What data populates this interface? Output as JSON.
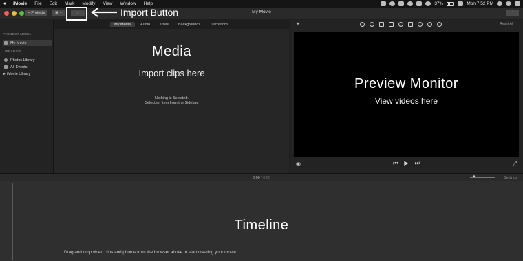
{
  "menubar": {
    "app": "iMovie",
    "items": [
      "File",
      "Edit",
      "Mark",
      "Modify",
      "View",
      "Window",
      "Help"
    ],
    "battery": "37%",
    "clock": "Mon 7:52 PM"
  },
  "toolbar": {
    "projects_label": "< Projects",
    "view_label": "▦ ▾",
    "import_label": "↓",
    "title": "My Movie",
    "share_label": "↑",
    "import_annotation": "Import Button"
  },
  "tabs": [
    {
      "label": "My Media",
      "active": true
    },
    {
      "label": "Audio",
      "active": false
    },
    {
      "label": "Titles",
      "active": false
    },
    {
      "label": "Backgrounds",
      "active": false
    },
    {
      "label": "Transitions",
      "active": false
    }
  ],
  "sidebar": {
    "project_media_header": "PROJECT MEDIA",
    "project_item": "My Movie",
    "libraries_header": "LIBRARIES",
    "library_items": [
      "Photos Library",
      "All Events",
      "iMovie Library"
    ]
  },
  "browser": {
    "annotation_title": "Media",
    "annotation_sub": "Import clips here",
    "empty_line1": "Nothing is Selected.",
    "empty_line2": "Select an item from the Sidebar."
  },
  "viewer": {
    "reset_all": "Reset All",
    "annotation_title": "Preview Monitor",
    "annotation_sub": "View videos here"
  },
  "timeline": {
    "current_time": "0:00",
    "separator": "/",
    "total_time": "0:00",
    "settings": "Settings",
    "annotation_title": "Timeline",
    "hint": "Drag and drop video clips and photos from the browser above to start creating your movie."
  },
  "colors": {
    "close": "#fc5b57",
    "minimize": "#e5bf3c",
    "zoom": "#57c038"
  }
}
